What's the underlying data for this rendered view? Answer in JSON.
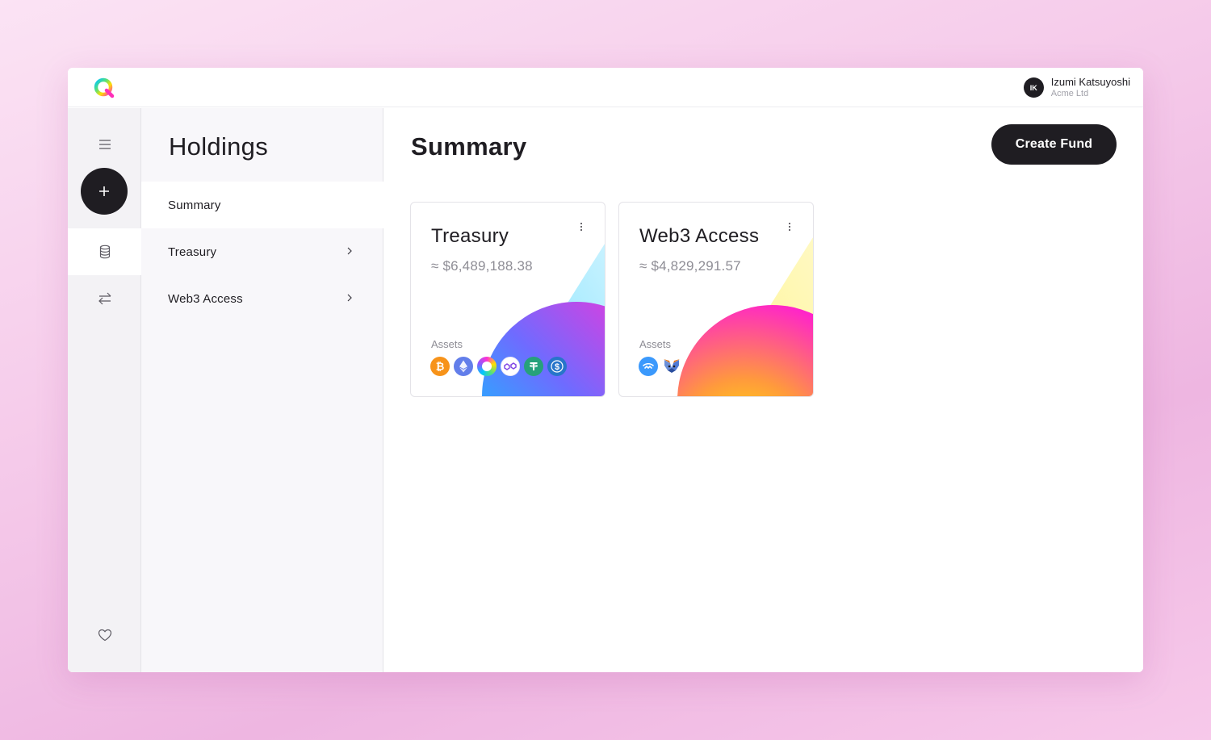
{
  "user": {
    "initials": "IK",
    "name": "Izumi Katsuyoshi",
    "org": "Acme Ltd"
  },
  "rail": {
    "icons": [
      "menu-icon",
      "plus-icon",
      "database-icon",
      "swap-arrows-icon",
      "heart-icon"
    ]
  },
  "subnav": {
    "title": "Holdings",
    "items": [
      {
        "label": "Summary"
      },
      {
        "label": "Treasury"
      },
      {
        "label": "Web3 Access"
      }
    ]
  },
  "main": {
    "title": "Summary",
    "create_label": "Create Fund",
    "cards": [
      {
        "title": "Treasury",
        "value": "≈ $6,489,188.38",
        "assets_label": "Assets",
        "assets": [
          "bitcoin-icon",
          "ethereum-icon",
          "token-ring-icon",
          "polygon-icon",
          "tether-icon",
          "usdc-icon"
        ]
      },
      {
        "title": "Web3 Access",
        "value": "≈ $4,829,291.57",
        "assets_label": "Assets",
        "assets": [
          "walletconnect-icon",
          "metamask-icon"
        ]
      }
    ]
  },
  "colors": {
    "dark": "#1f1d22",
    "muted": "#8e8d95",
    "bitcoin": "#f7931a",
    "ethereum": "#627eea",
    "tether": "#26a17b",
    "usdc": "#2775ca"
  }
}
